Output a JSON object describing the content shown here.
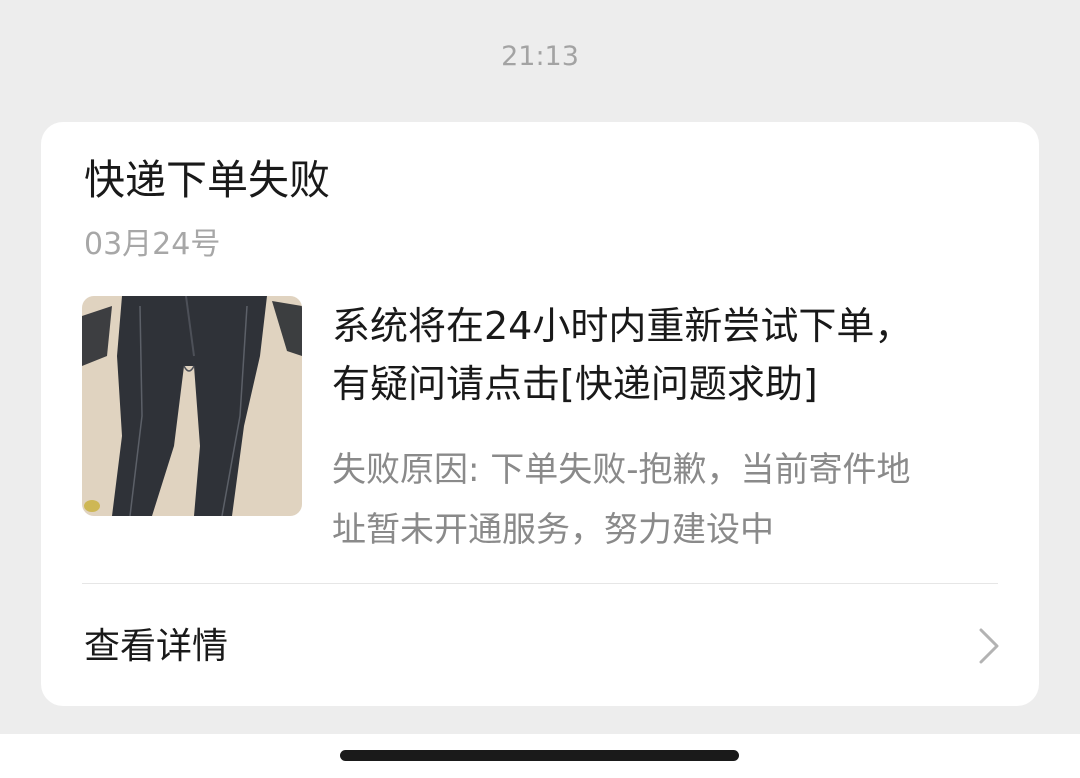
{
  "timestamp": "21:13",
  "card": {
    "title": "快递下单失败",
    "date": "03月24号",
    "thumbnail_icon": "jeans-product-photo",
    "main_line1": "系统将在24小时内重新尝试下单，",
    "main_line2": "有疑问请点击[快递问题求助]",
    "reason_line1": "失败原因: 下单失败-抱歉，当前寄件地",
    "reason_line2": "址暂未开通服务，努力建设中",
    "details_label": "查看详情",
    "details_icon": "chevron-right-icon"
  },
  "colors": {
    "background": "#ededed",
    "card": "#ffffff",
    "primary_text": "#191919",
    "secondary_text": "#8a8a8a",
    "timestamp_text": "#a3a3a3"
  }
}
